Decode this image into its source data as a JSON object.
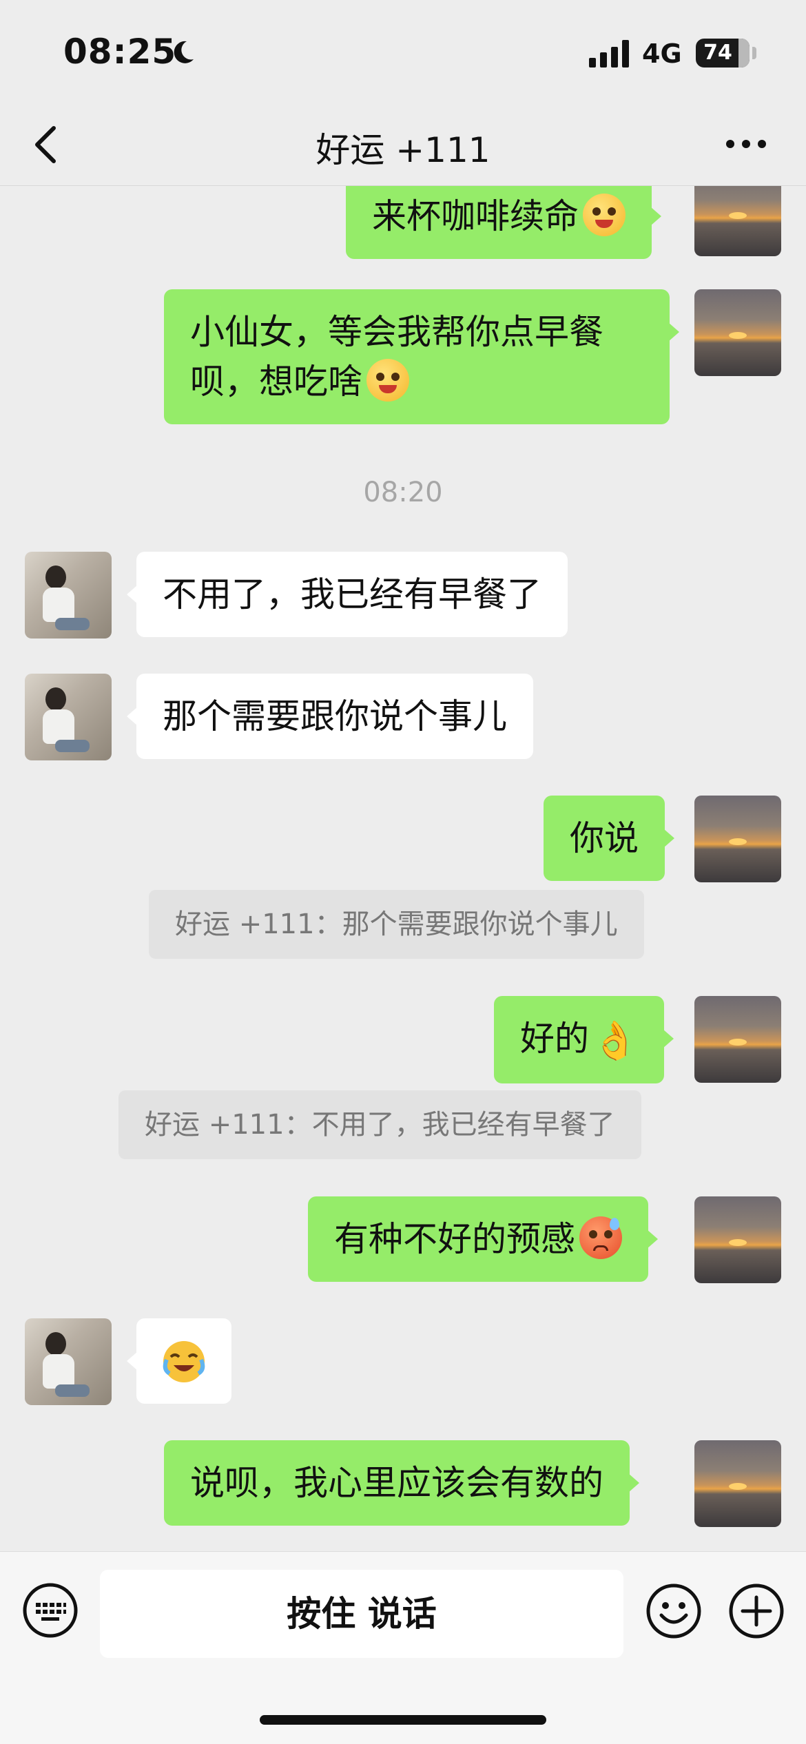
{
  "status_bar": {
    "time": "08:25",
    "network": "4G",
    "battery": "74"
  },
  "header": {
    "title": "好运 +111"
  },
  "messages": {
    "m1": {
      "text": "来杯咖啡续命"
    },
    "m2": {
      "line1": "小仙女，等会我帮你点早餐",
      "line2": "呗，想吃啥"
    },
    "timestamp": "08:20",
    "m3": {
      "text": "不用了，我已经有早餐了"
    },
    "m4": {
      "text": "那个需要跟你说个事儿"
    },
    "m5": {
      "text": "你说"
    },
    "q1": {
      "text": "好运 +111：那个需要跟你说个事儿"
    },
    "m6": {
      "text": "好的"
    },
    "q2": {
      "text": "好运 +111：不用了，我已经有早餐了"
    },
    "m7": {
      "text": "有种不好的预感"
    },
    "m8": {
      "emoji": "crying-laughing-emoji"
    },
    "m9": {
      "text": "说呗，我心里应该会有数的"
    }
  },
  "input_bar": {
    "talk_label": "按住 说话"
  },
  "colors": {
    "sent_bubble": "#95ec69",
    "received_bubble": "#ffffff",
    "background": "#ededed"
  }
}
